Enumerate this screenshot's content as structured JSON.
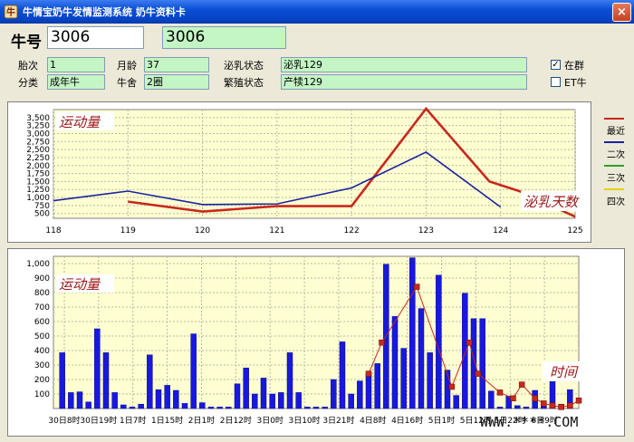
{
  "window": {
    "title": "牛情宝奶牛发情监测系统  奶牛资料卡",
    "close_label": "×"
  },
  "header": {
    "cow_id_label": "牛号",
    "cow_id_input": "3006",
    "cow_id_display": "3006"
  },
  "info": {
    "parity_label": "胎次",
    "parity": "1",
    "category_label": "分类",
    "category": "成年牛",
    "age_label": "月龄",
    "age": "37",
    "barn_label": "牛舍",
    "barn": "2圈",
    "lactation_label": "泌乳状态",
    "lactation": "泌乳129",
    "breeding_label": "繁殖状态",
    "breeding": "产犊129",
    "in_herd_label": "在群",
    "in_herd_checked": true,
    "et_label": "ET牛",
    "et_checked": false
  },
  "legend": [
    {
      "label": "最近",
      "color": "#c8281e"
    },
    {
      "label": "二次",
      "color": "#1a23a0"
    },
    {
      "label": "三次",
      "color": "#2aa02a"
    },
    {
      "label": "四次",
      "color": "#e8d010"
    }
  ],
  "watermark": "WWW.****.COM",
  "chart_data": [
    {
      "type": "line",
      "annotations": [
        "运动量",
        "泌乳天数"
      ],
      "x": [
        118,
        119,
        120,
        121,
        122,
        123,
        124,
        125
      ],
      "ylim": [
        350,
        3750
      ],
      "yticks": [
        500,
        750,
        1000,
        1250,
        1500,
        1750,
        2000,
        2250,
        2500,
        2750,
        3000,
        3250,
        3500
      ],
      "ytick_labels": [
        "500",
        "750",
        "1,000",
        "1,250",
        "1,500",
        "1,750",
        "2,000",
        "2,250",
        "2,500",
        "2,750",
        "3,000",
        "3,250",
        "3,500"
      ],
      "grid": true,
      "series": [
        {
          "name": "最近",
          "color": "#c8281e",
          "x": [
            119,
            120,
            121,
            122,
            123,
            123.85,
            124.25,
            125
          ],
          "values": [
            870,
            560,
            730,
            730,
            3780,
            1500,
            1200,
            400
          ]
        },
        {
          "name": "二次",
          "color": "#1a23a0",
          "x": [
            118,
            119,
            120,
            121,
            122,
            123,
            124
          ],
          "values": [
            900,
            1200,
            780,
            800,
            1300,
            2420,
            700
          ]
        }
      ]
    },
    {
      "type": "bar",
      "annotations": [
        "运动量",
        "时间"
      ],
      "xtick_labels": [
        "30日8时",
        "30日19时",
        "1日7时",
        "1日15时",
        "2日1时",
        "2日12时",
        "3日0时",
        "3日10时",
        "3日21时",
        "4日8时",
        "4日16时",
        "5日1时",
        "5日12时",
        "5日22时",
        "6日9时"
      ],
      "ylim": [
        0,
        1050
      ],
      "yticks": [
        100,
        200,
        300,
        400,
        500,
        600,
        700,
        800,
        900,
        1000
      ],
      "ytick_labels": [
        "100",
        "200",
        "300",
        "400",
        "500",
        "600",
        "700",
        "800",
        "900",
        "1,000"
      ],
      "grid": true,
      "values": [
        385,
        110,
        115,
        45,
        550,
        385,
        110,
        25,
        10,
        30,
        370,
        130,
        160,
        125,
        35,
        515,
        40,
        10,
        10,
        10,
        170,
        280,
        100,
        210,
        100,
        110,
        385,
        110,
        10,
        10,
        10,
        200,
        460,
        100,
        190,
        245,
        310,
        995,
        635,
        415,
        1040,
        690,
        385,
        920,
        265,
        90,
        795,
        620,
        620,
        120,
        10,
        85,
        20,
        10,
        125,
        20,
        245,
        30,
        130
      ],
      "overlay": {
        "color": "#c8281e",
        "points": [
          [
            36,
            240
          ],
          [
            37.5,
            455
          ],
          [
            41.5,
            840
          ],
          [
            47.5,
            455
          ],
          [
            48.5,
            240
          ],
          [
            45.5,
            150
          ],
          [
            51,
            110
          ],
          [
            52.5,
            70
          ],
          [
            53.5,
            165
          ],
          [
            55,
            70
          ],
          [
            56,
            35
          ],
          [
            57,
            20
          ],
          [
            58,
            10
          ],
          [
            59,
            20
          ],
          [
            60,
            55
          ]
        ]
      }
    }
  ]
}
